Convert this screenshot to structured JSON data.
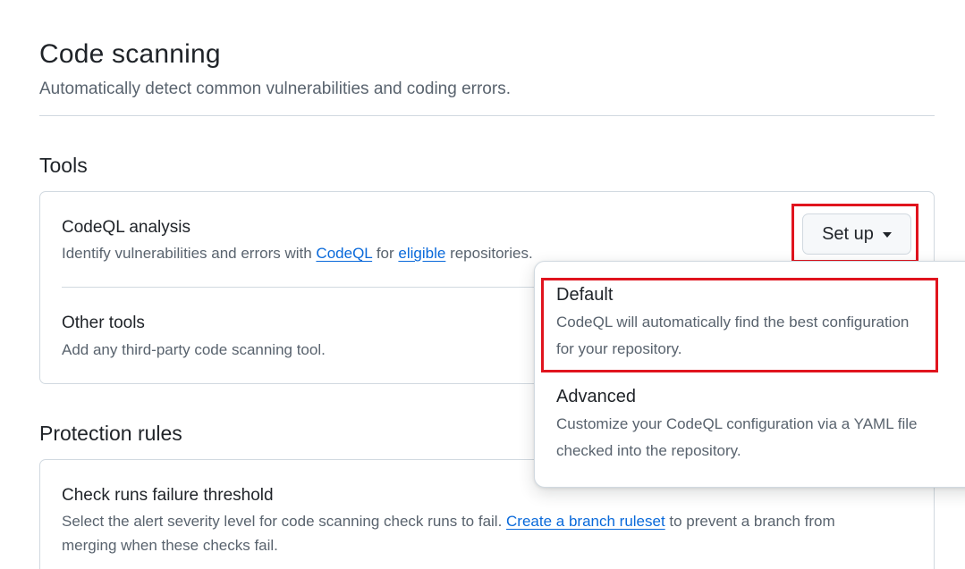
{
  "header": {
    "title": "Code scanning",
    "subtitle": "Automatically detect common vulnerabilities and coding errors."
  },
  "tools": {
    "heading": "Tools",
    "codeql": {
      "title": "CodeQL analysis",
      "desc_before": "Identify vulnerabilities and errors with ",
      "link_codeql": "CodeQL",
      "desc_mid": " for ",
      "link_eligible": "eligible",
      "desc_after": " repositories.",
      "setup_label": "Set up"
    },
    "other": {
      "title": "Other tools",
      "desc": "Add any third-party code scanning tool."
    }
  },
  "setup_menu": {
    "items": [
      {
        "title": "Default",
        "desc_line1": "CodeQL will automatically find the best configuration",
        "desc_line2": "for your repository."
      },
      {
        "title": "Advanced",
        "desc_line1": "Customize your CodeQL configuration via a YAML file",
        "desc_line2": "checked into the repository."
      }
    ]
  },
  "protection": {
    "heading": "Protection rules",
    "check_runs": {
      "title": "Check runs failure threshold",
      "desc_before": "Select the alert severity level for code scanning check runs to fail. ",
      "link": "Create a branch ruleset",
      "desc_after": " to prevent a branch from",
      "desc_line2": "merging when these checks fail."
    }
  },
  "colors": {
    "highlight": "#e0141e",
    "link": "#0969da",
    "muted": "#59636e",
    "border": "#d1d9e0"
  }
}
